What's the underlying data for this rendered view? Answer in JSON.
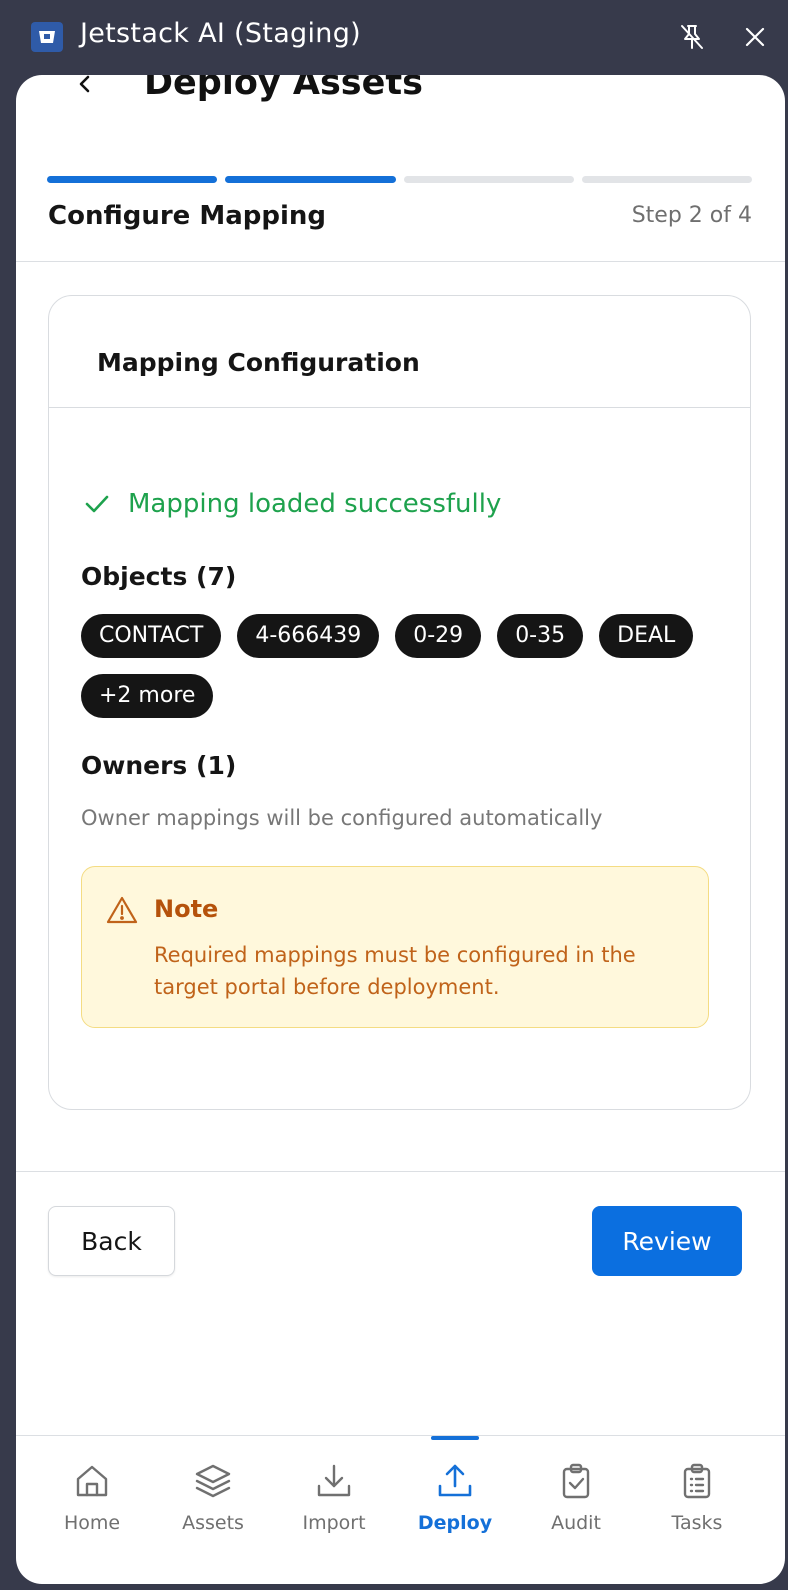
{
  "window": {
    "title": "Jetstack AI (Staging)"
  },
  "header": {
    "title": "Deploy Assets"
  },
  "progress": {
    "current_step": 2,
    "total_steps": 4,
    "step_title": "Configure Mapping",
    "step_label": "Step 2 of 4"
  },
  "card": {
    "title": "Mapping Configuration",
    "status_text": "Mapping loaded successfully",
    "objects_title": "Objects (7)",
    "objects": [
      "CONTACT",
      "4-666439",
      "0-29",
      "0-35",
      "DEAL",
      "+2 more"
    ],
    "owners_title": "Owners (1)",
    "owners_desc": "Owner mappings will be configured automatically",
    "note": {
      "title": "Note",
      "body": "Required mappings must be configured in the target portal before deployment."
    }
  },
  "actions": {
    "back_label": "Back",
    "review_label": "Review"
  },
  "nav": {
    "items": [
      {
        "label": "Home",
        "icon": "home-icon",
        "active": false
      },
      {
        "label": "Assets",
        "icon": "layers-icon",
        "active": false
      },
      {
        "label": "Import",
        "icon": "download-icon",
        "active": false
      },
      {
        "label": "Deploy",
        "icon": "upload-icon",
        "active": true
      },
      {
        "label": "Audit",
        "icon": "clipboard-check-icon",
        "active": false
      },
      {
        "label": "Tasks",
        "icon": "clipboard-list-icon",
        "active": false
      }
    ]
  },
  "colors": {
    "accent": "#1470d8",
    "success": "#1ea24d",
    "warning_text": "#c0631a",
    "warning_bg": "#fff8dc",
    "chip_bg": "#151515"
  }
}
